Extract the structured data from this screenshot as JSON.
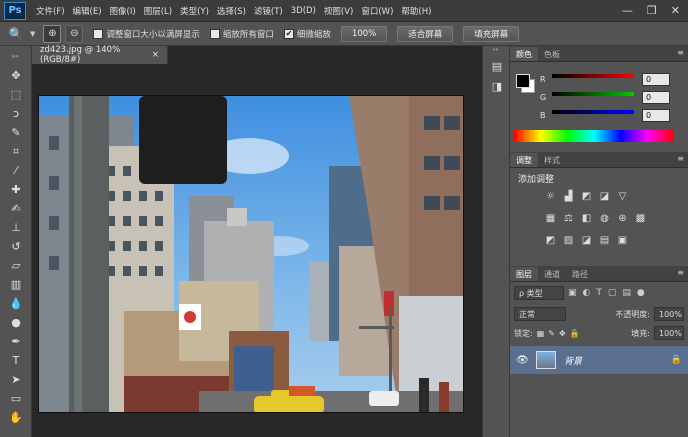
{
  "app": {
    "logo": "Ps"
  },
  "menu": [
    "文件(F)",
    "编辑(E)",
    "图像(I)",
    "图层(L)",
    "类型(Y)",
    "选择(S)",
    "滤镜(T)",
    "3D(D)",
    "视图(V)",
    "窗口(W)",
    "帮助(H)"
  ],
  "window_controls": {
    "minimize": "—",
    "restore": "❐",
    "close": "✕"
  },
  "options": {
    "resize_windows": "调整窗口大小以满屏显示",
    "zoom_all_windows": "缩放所有窗口",
    "scrubby_zoom": "细微缩放",
    "btn_100": "100%",
    "btn_fit": "适合屏幕",
    "btn_fill": "填充屏幕"
  },
  "document": {
    "tab_title": "zd423.jpg @ 140%(RGB/8#)",
    "close": "×"
  },
  "color_panel": {
    "tabs": [
      "颜色",
      "色板"
    ],
    "sliders": [
      {
        "label": "R",
        "value": "0",
        "gradient": "#ff0000"
      },
      {
        "label": "G",
        "value": "0",
        "gradient": "#00cc00"
      },
      {
        "label": "B",
        "value": "0",
        "gradient": "#0000ff"
      }
    ]
  },
  "adjust_panel": {
    "tabs": [
      "调整",
      "样式"
    ],
    "title": "添加调整"
  },
  "layers_panel": {
    "tabs": [
      "图层",
      "通道",
      "路径"
    ],
    "filter_kind": "ρ 类型",
    "blend_mode": "正常",
    "opacity_label": "不透明度:",
    "opacity_value": "100%",
    "lock_label": "锁定:",
    "fill_label": "填充:",
    "fill_value": "100%",
    "layer_name": "背景"
  }
}
